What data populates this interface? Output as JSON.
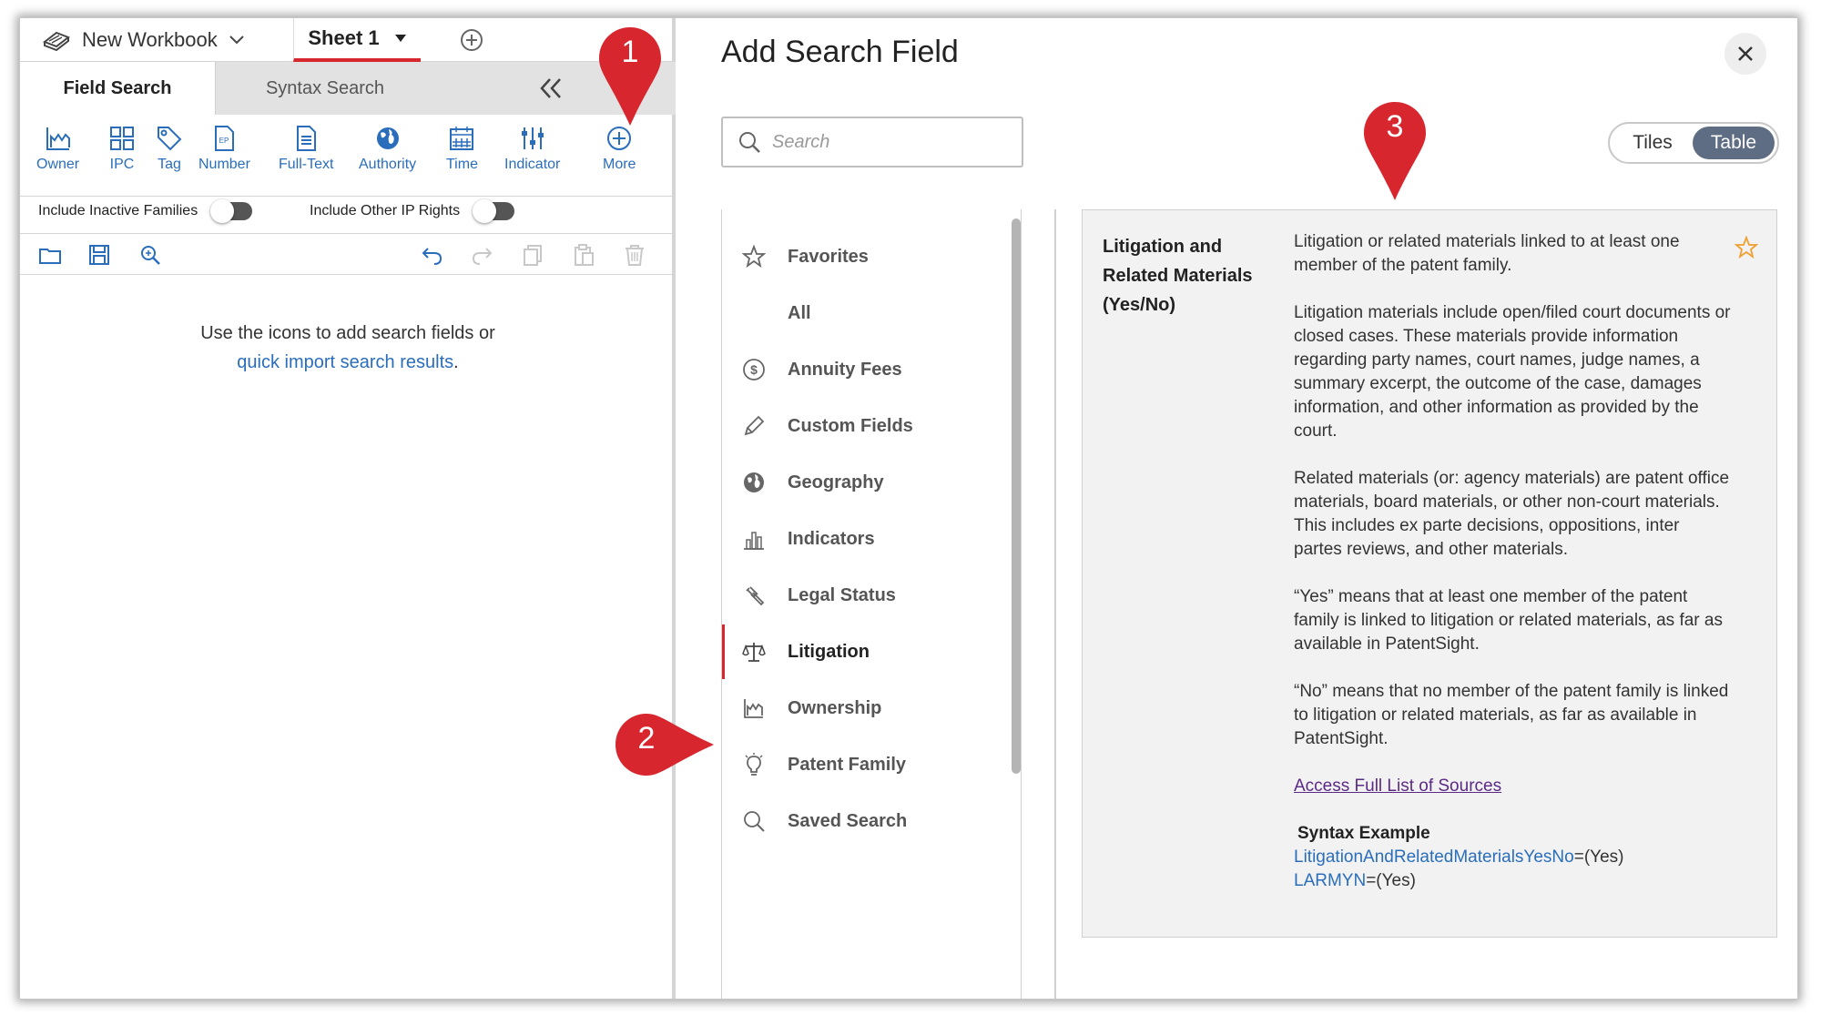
{
  "workbook": {
    "name": "New Workbook",
    "sheet_tab": "Sheet 1"
  },
  "search_tabs": {
    "field_search": "Field Search",
    "syntax_search": "Syntax Search"
  },
  "field_icons": [
    {
      "label": "Owner",
      "icon": "owner-icon"
    },
    {
      "label": "IPC",
      "icon": "ipc-grid-icon"
    },
    {
      "label": "Tag",
      "icon": "tag-icon"
    },
    {
      "label": "Number",
      "icon": "number-document-icon"
    },
    {
      "label": "Full-Text",
      "icon": "document-icon"
    },
    {
      "label": "Authority",
      "icon": "globe-icon"
    },
    {
      "label": "Time",
      "icon": "calendar-icon"
    },
    {
      "label": "Indicator",
      "icon": "sliders-icon"
    },
    {
      "label": "More",
      "icon": "plus-circle-icon"
    }
  ],
  "toggles": {
    "inactive_families": "Include Inactive Families",
    "other_ip_rights": "Include Other IP Rights"
  },
  "empty_state": {
    "line1": "Use the icons to add search fields or",
    "link": "quick import search results",
    "link_suffix": "."
  },
  "dialog": {
    "title": "Add Search Field",
    "search_placeholder": "Search",
    "view_tiles": "Tiles",
    "view_table": "Table",
    "categories": [
      {
        "label": "Favorites",
        "icon": "star-icon"
      },
      {
        "label": "All",
        "icon": ""
      },
      {
        "label": "Annuity Fees",
        "icon": "dollar-icon"
      },
      {
        "label": "Custom Fields",
        "icon": "pencil-icon"
      },
      {
        "label": "Geography",
        "icon": "globe-icon"
      },
      {
        "label": "Indicators",
        "icon": "bar-chart-icon"
      },
      {
        "label": "Legal Status",
        "icon": "gavel-icon"
      },
      {
        "label": "Litigation",
        "icon": "scales-icon"
      },
      {
        "label": "Ownership",
        "icon": "owner-icon"
      },
      {
        "label": "Patent Family",
        "icon": "lightbulb-icon"
      },
      {
        "label": "Saved Search",
        "icon": "search-icon"
      }
    ],
    "active_category": "Litigation",
    "field": {
      "name_line1": "Litigation and",
      "name_line2": "Related Materials",
      "name_line3": "(Yes/No)",
      "p1": "Litigation or related materials linked to at least one member of the patent family.",
      "p2": "Litigation materials include open/filed court documents or closed cases. These materials provide information regarding party names, court names, judge names, a summary excerpt, the outcome of the case, damages information, and other information as provided by the court.",
      "p3": "Related materials (or: agency materials) are patent office materials, board materials, or other non-court materials. This includes ex parte decisions, oppositions, inter partes reviews, and other materials.",
      "p4": "“Yes” means that at least one member of the patent family is linked to litigation or related materials, as far as available in PatentSight.",
      "p5": "“No” means that no member of the patent family is linked to litigation or related materials, as far as available in PatentSight.",
      "sources_link": "Access Full List of Sources",
      "syntax_title": "Syntax Example",
      "syntax1_field": "LitigationAndRelatedMaterialsYesNo",
      "syntax1_value": "=(Yes)",
      "syntax2_field": "LARMYN",
      "syntax2_value": "=(Yes)"
    }
  },
  "callouts": [
    "1",
    "2",
    "3"
  ],
  "colors": {
    "accent_red": "#d7262e",
    "link_blue": "#2a6ebb",
    "visited_purple": "#5b2a86",
    "star_orange": "#f0a030",
    "toggle_active": "#5e6c84"
  }
}
